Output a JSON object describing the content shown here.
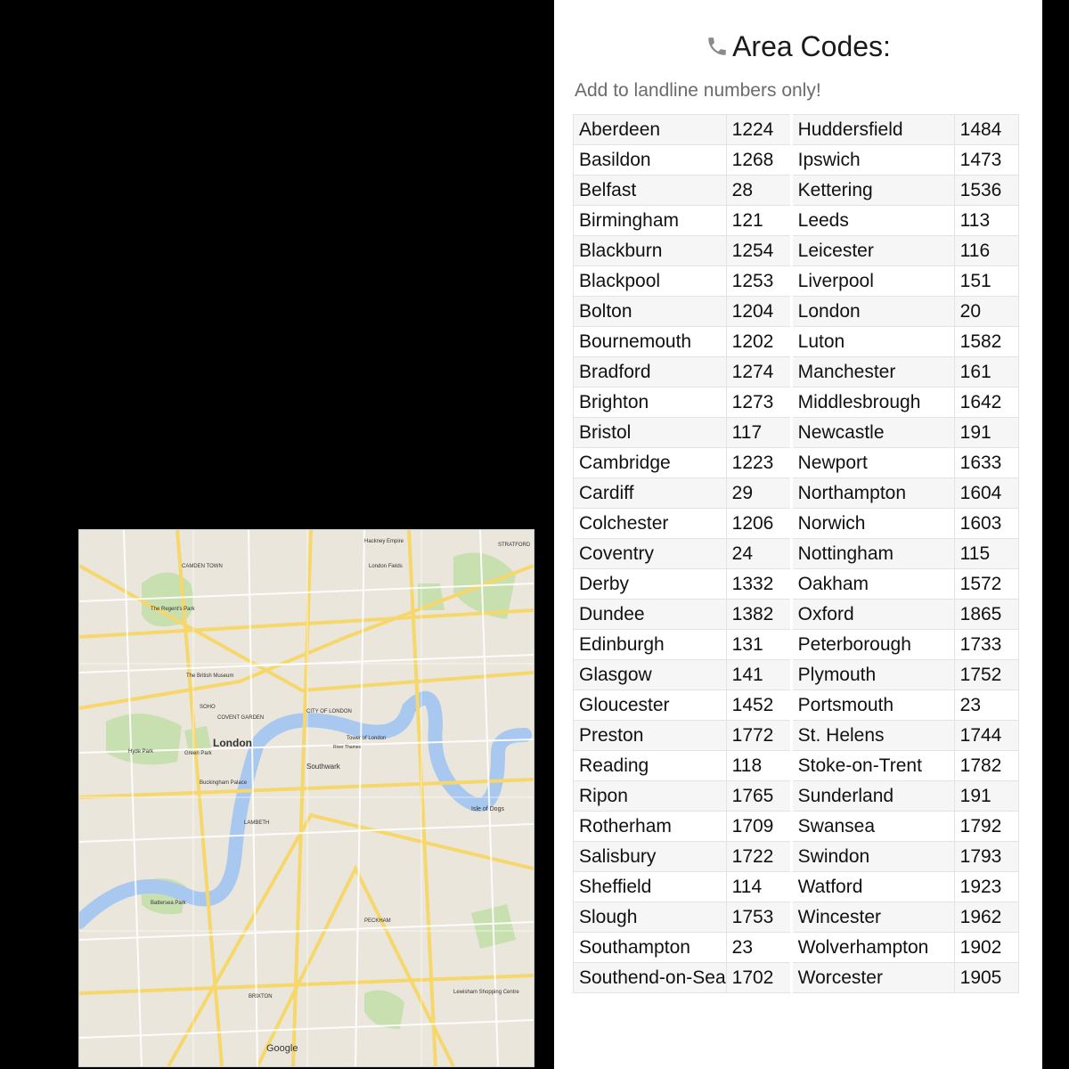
{
  "header": {
    "title": "Area Codes:",
    "subtitle": "Add to landline numbers only!",
    "icon": "phone-icon"
  },
  "area_codes": {
    "left": [
      {
        "city": "Aberdeen",
        "code": "1224"
      },
      {
        "city": "Basildon",
        "code": "1268"
      },
      {
        "city": "Belfast",
        "code": "28"
      },
      {
        "city": "Birmingham",
        "code": "121"
      },
      {
        "city": "Blackburn",
        "code": "1254"
      },
      {
        "city": "Blackpool",
        "code": "1253"
      },
      {
        "city": "Bolton",
        "code": "1204"
      },
      {
        "city": "Bournemouth",
        "code": "1202"
      },
      {
        "city": "Bradford",
        "code": "1274"
      },
      {
        "city": "Brighton",
        "code": "1273"
      },
      {
        "city": "Bristol",
        "code": "117"
      },
      {
        "city": "Cambridge",
        "code": "1223"
      },
      {
        "city": "Cardiff",
        "code": "29"
      },
      {
        "city": "Colchester",
        "code": "1206"
      },
      {
        "city": "Coventry",
        "code": "24"
      },
      {
        "city": "Derby",
        "code": "1332"
      },
      {
        "city": "Dundee",
        "code": "1382"
      },
      {
        "city": "Edinburgh",
        "code": "131"
      },
      {
        "city": "Glasgow",
        "code": "141"
      },
      {
        "city": "Gloucester",
        "code": "1452"
      },
      {
        "city": "Preston",
        "code": "1772"
      },
      {
        "city": "Reading",
        "code": "118"
      },
      {
        "city": "Ripon",
        "code": "1765"
      },
      {
        "city": "Rotherham",
        "code": "1709"
      },
      {
        "city": "Salisbury",
        "code": "1722"
      },
      {
        "city": "Sheffield",
        "code": "114"
      },
      {
        "city": "Slough",
        "code": "1753"
      },
      {
        "city": "Southampton",
        "code": "23"
      },
      {
        "city": "Southend-on-Sea",
        "code": "1702"
      }
    ],
    "right": [
      {
        "city": "Huddersfield",
        "code": "1484"
      },
      {
        "city": "Ipswich",
        "code": "1473"
      },
      {
        "city": "Kettering",
        "code": "1536"
      },
      {
        "city": "Leeds",
        "code": "113"
      },
      {
        "city": "Leicester",
        "code": "116"
      },
      {
        "city": "Liverpool",
        "code": "151"
      },
      {
        "city": "London",
        "code": "20"
      },
      {
        "city": "Luton",
        "code": "1582"
      },
      {
        "city": "Manchester",
        "code": "161"
      },
      {
        "city": "Middlesbrough",
        "code": "1642"
      },
      {
        "city": "Newcastle",
        "code": "191"
      },
      {
        "city": "Newport",
        "code": "1633"
      },
      {
        "city": "Northampton",
        "code": "1604"
      },
      {
        "city": "Norwich",
        "code": "1603"
      },
      {
        "city": "Nottingham",
        "code": "115"
      },
      {
        "city": "Oakham",
        "code": "1572"
      },
      {
        "city": "Oxford",
        "code": "1865"
      },
      {
        "city": "Peterborough",
        "code": "1733"
      },
      {
        "city": "Plymouth",
        "code": "1752"
      },
      {
        "city": "Portsmouth",
        "code": "23"
      },
      {
        "city": "St. Helens",
        "code": "1744"
      },
      {
        "city": "Stoke-on-Trent",
        "code": "1782"
      },
      {
        "city": "Sunderland",
        "code": "191"
      },
      {
        "city": "Swansea",
        "code": "1792"
      },
      {
        "city": "Swindon",
        "code": "1793"
      },
      {
        "city": "Watford",
        "code": "1923"
      },
      {
        "city": "Wincester",
        "code": "1962"
      },
      {
        "city": "Wolverhampton",
        "code": "1902"
      },
      {
        "city": "Worcester",
        "code": "1905"
      }
    ]
  },
  "map": {
    "labels": {
      "london": "London",
      "southwark": "Southwark",
      "city_of_london": "CITY OF LONDON",
      "hyde_park": "Hyde Park",
      "green_park": "Green Park",
      "battersea_park": "Battersea Park",
      "isle_of_dogs": "Isle of Dogs",
      "regents_park": "The Regent's Park",
      "british_museum": "The British Museum",
      "tower_of_london": "Tower of London",
      "buckingham_palace": "Buckingham Palace",
      "covent_garden": "COVENT GARDEN",
      "soho": "SOHO",
      "river": "River Thames",
      "google": "Google",
      "hackney": "Hackney Empire",
      "stratford": "STRATFORD",
      "london_fields": "London Fields",
      "peckham": "PECKHAM",
      "brixton": "BRIXTON",
      "camden": "CAMDEN TOWN",
      "lambeth": "LAMBETH",
      "lewisham": "Lewisham Shopping Centre"
    },
    "colors": {
      "land": "#ebe6dc",
      "park": "#c8dfb0",
      "water": "#a8c8f0",
      "major_road": "#f6d76b",
      "minor_road": "#ffffff"
    }
  }
}
